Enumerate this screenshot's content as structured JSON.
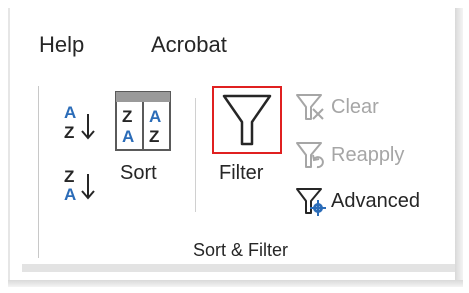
{
  "tabs": [
    {
      "label": "Help"
    },
    {
      "label": "Acrobat"
    }
  ],
  "sort_filter_group": {
    "group_label": "Sort & Filter",
    "sort_label": "Sort",
    "filter_label": "Filter",
    "clear_label": "Clear",
    "reapply_label": "Reapply",
    "advanced_label": "Advanced",
    "sort_az_icon": "sort-a-to-z-icon",
    "sort_za_icon": "sort-z-to-a-icon",
    "sort_icon": "sort-dialog-icon",
    "filter_icon": "filter-funnel-icon",
    "clear_icon": "clear-filter-icon",
    "reapply_icon": "reapply-filter-icon",
    "advanced_icon": "advanced-filter-icon",
    "filter_highlighted": true
  },
  "colors": {
    "highlight": "#e02020",
    "accent_blue": "#2b6cb8",
    "text": "#262626",
    "disabled_text": "#a6a6a6"
  }
}
